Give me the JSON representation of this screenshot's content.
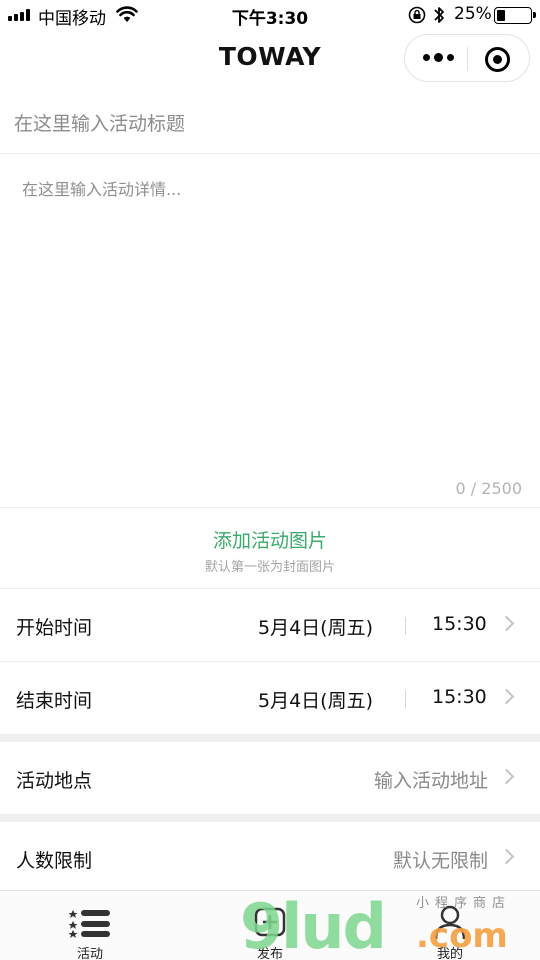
{
  "status_bar": {
    "carrier": "中国移动",
    "time": "下午3:30",
    "battery_percent_label": "25%",
    "battery_level": 0.25,
    "icons": [
      "signal-icon",
      "wifi-icon",
      "orientation-lock-icon",
      "bluetooth-icon",
      "battery-icon"
    ]
  },
  "nav": {
    "title": "TOWAY",
    "icons": [
      "more-icon",
      "close-icon"
    ]
  },
  "form": {
    "title_placeholder": "在这里输入活动标题",
    "detail_placeholder": "在这里输入活动详情...",
    "char_counter": "0 / 2500",
    "add_image_label": "添加活动图片",
    "add_image_hint": "默认第一张为封面图片"
  },
  "rows": {
    "start": {
      "label": "开始时间",
      "date": "5月4日(周五)",
      "time": "15:30"
    },
    "end": {
      "label": "结束时间",
      "date": "5月4日(周五)",
      "time": "15:30"
    },
    "location": {
      "label": "活动地点",
      "value": "输入活动地址"
    },
    "limit": {
      "label": "人数限制",
      "value": "默认无限制"
    }
  },
  "tabs": [
    {
      "label": "活动",
      "icon": "list-icon"
    },
    {
      "label": "发布",
      "icon": "add-icon"
    },
    {
      "label": "我的",
      "icon": "user-icon"
    }
  ],
  "watermark": {
    "big": "9lud",
    "com": ".com",
    "small": "小程序商店"
  },
  "colors": {
    "accent_green": "#3aaa6a",
    "hint_gray": "#a4a4a4",
    "separator_gray": "#efefef"
  }
}
